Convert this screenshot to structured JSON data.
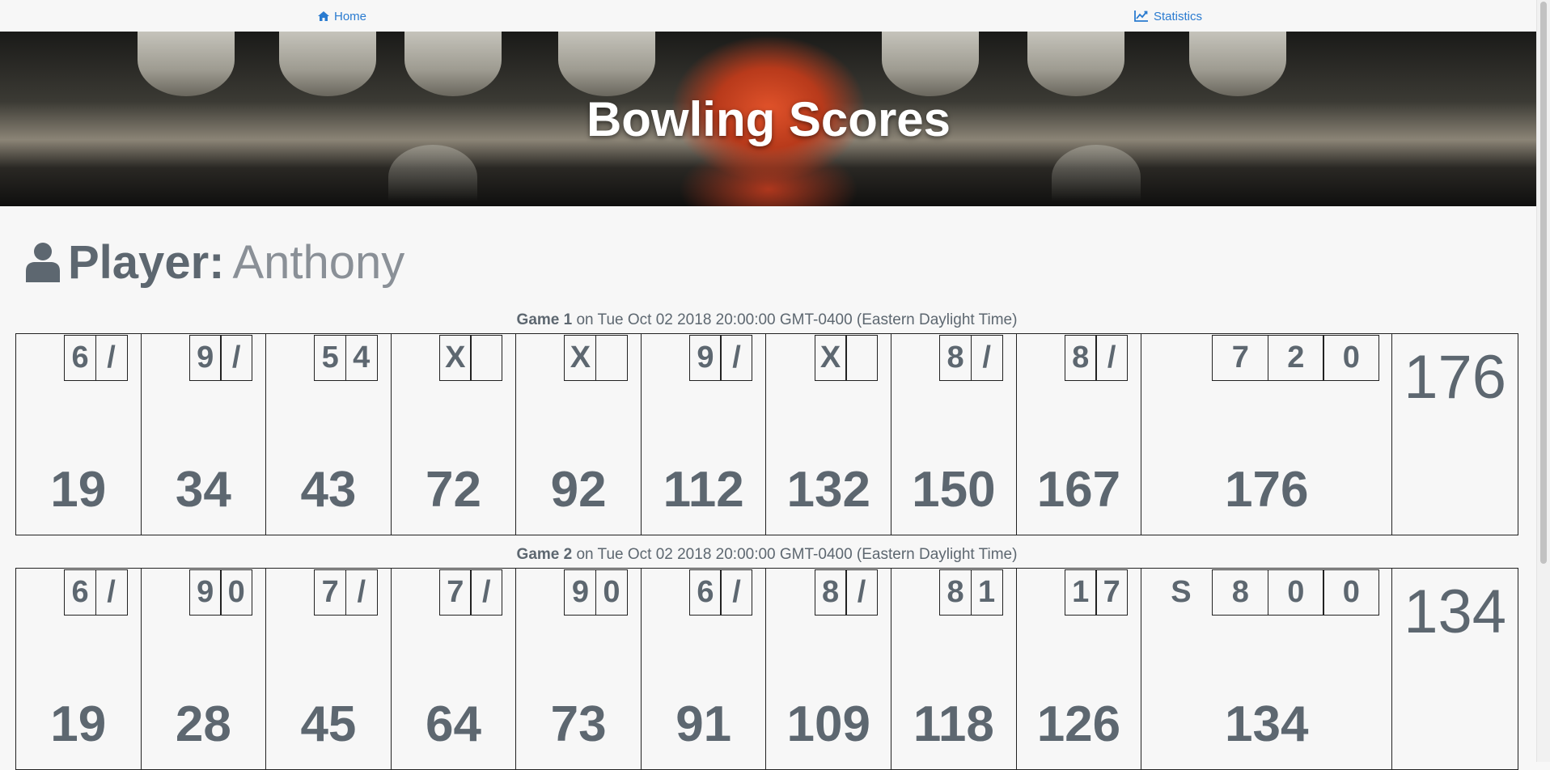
{
  "nav": {
    "home_label": "Home",
    "home_icon": "home-icon",
    "stats_label": "Statistics",
    "stats_icon": "line-chart-icon",
    "link_color": "#2a7bd0"
  },
  "hero": {
    "title": "Bowling Scores"
  },
  "player": {
    "label": "Player:",
    "name": "Anthony",
    "icon": "user-icon"
  },
  "games": [
    {
      "title": "Game 1",
      "date_text": " on Tue Oct 02 2018 20:00:00 GMT-0400 (Eastern Daylight Time)",
      "frames": [
        {
          "rolls": [
            "6",
            "/"
          ],
          "score": "19"
        },
        {
          "rolls": [
            "9",
            "/"
          ],
          "score": "34"
        },
        {
          "rolls": [
            "5",
            "4"
          ],
          "score": "43"
        },
        {
          "rolls": [
            "X",
            ""
          ],
          "score": "72"
        },
        {
          "rolls": [
            "X",
            ""
          ],
          "score": "92"
        },
        {
          "rolls": [
            "9",
            "/"
          ],
          "score": "112"
        },
        {
          "rolls": [
            "X",
            ""
          ],
          "score": "132"
        },
        {
          "rolls": [
            "8",
            "/"
          ],
          "score": "150"
        },
        {
          "rolls": [
            "8",
            "/"
          ],
          "score": "167"
        }
      ],
      "tenth": {
        "split": "",
        "rolls": [
          "7",
          "2",
          "0"
        ],
        "score": "176"
      },
      "total": "176"
    },
    {
      "title": "Game 2",
      "date_text": " on Tue Oct 02 2018 20:00:00 GMT-0400 (Eastern Daylight Time)",
      "frames": [
        {
          "rolls": [
            "6",
            "/"
          ],
          "score": "19"
        },
        {
          "rolls": [
            "9",
            "0"
          ],
          "score": "28"
        },
        {
          "rolls": [
            "7",
            "/"
          ],
          "score": "45"
        },
        {
          "rolls": [
            "7",
            "/"
          ],
          "score": "64"
        },
        {
          "rolls": [
            "9",
            "0"
          ],
          "score": "73"
        },
        {
          "rolls": [
            "6",
            "/"
          ],
          "score": "91"
        },
        {
          "rolls": [
            "8",
            "/"
          ],
          "score": "109"
        },
        {
          "rolls": [
            "8",
            "1"
          ],
          "score": "118"
        },
        {
          "rolls": [
            "1",
            "7"
          ],
          "score": "126"
        }
      ],
      "tenth": {
        "split": "S",
        "rolls": [
          "8",
          "0",
          "0"
        ],
        "score": "134"
      },
      "total": "134"
    }
  ]
}
